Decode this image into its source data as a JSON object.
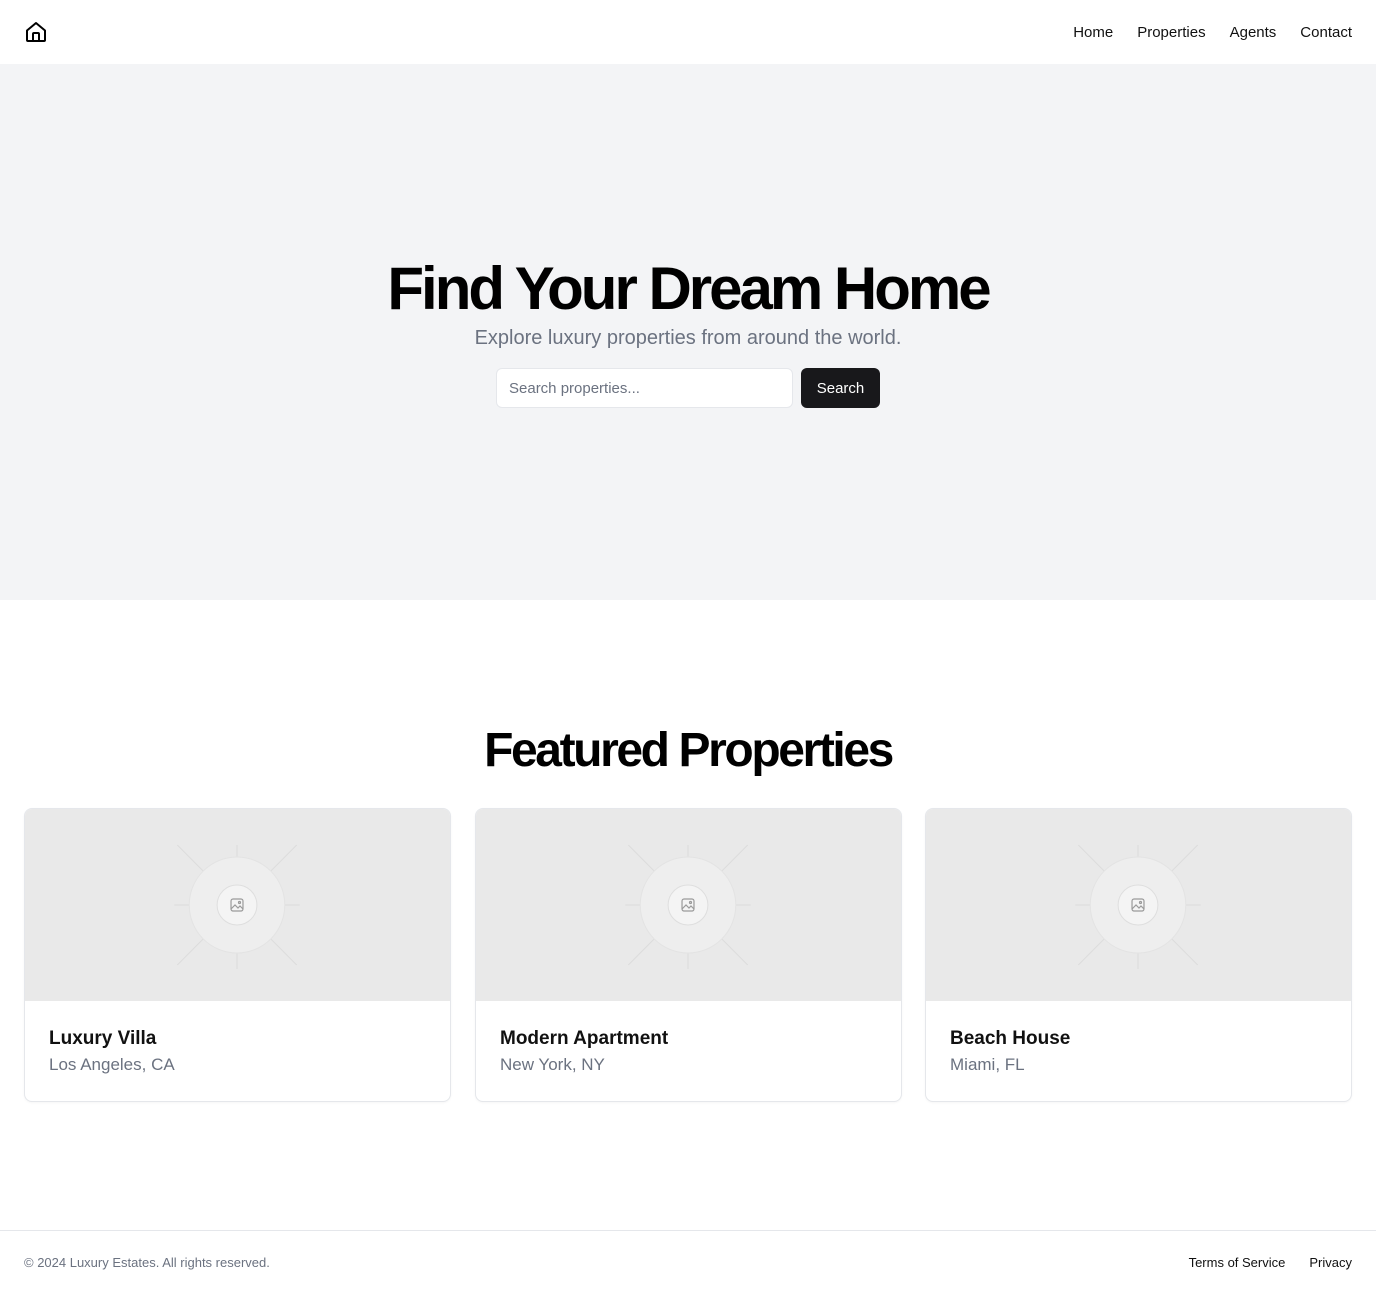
{
  "header": {
    "logo_icon": "house-icon",
    "nav": [
      "Home",
      "Properties",
      "Agents",
      "Contact"
    ]
  },
  "hero": {
    "title": "Find Your Dream Home",
    "subtitle": "Explore luxury properties from around the world.",
    "search_placeholder": "Search properties...",
    "search_button": "Search"
  },
  "featured": {
    "title": "Featured Properties",
    "cards": [
      {
        "title": "Luxury Villa",
        "location": "Los Angeles, CA",
        "image_icon": "image-placeholder-icon"
      },
      {
        "title": "Modern Apartment",
        "location": "New York, NY",
        "image_icon": "image-placeholder-icon"
      },
      {
        "title": "Beach House",
        "location": "Miami, FL",
        "image_icon": "image-placeholder-icon"
      }
    ]
  },
  "footer": {
    "copyright": "© 2024 Luxury Estates. All rights reserved.",
    "links": [
      "Terms of Service",
      "Privacy"
    ]
  },
  "colors": {
    "hero_background": "#f3f4f6",
    "button_background": "#18181b",
    "muted_text": "#6b7280",
    "border": "#e5e7eb",
    "image_placeholder": "#e9e9e9"
  }
}
